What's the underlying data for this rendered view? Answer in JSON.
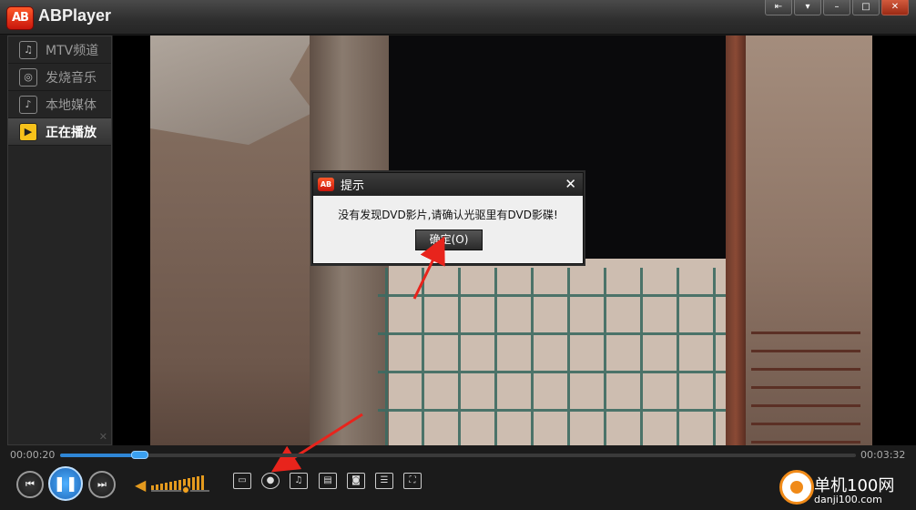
{
  "app": {
    "logo_text": "AB",
    "title": "ABPlayer"
  },
  "window_controls": [
    "restore-mini-icon",
    "dropdown-icon",
    "minimize-icon",
    "maximize-icon",
    "close-icon"
  ],
  "sidebar": {
    "items": [
      {
        "label": "MTV频道",
        "icon": "music-score-icon",
        "active": false
      },
      {
        "label": "发烧音乐",
        "icon": "disc-icon",
        "active": false
      },
      {
        "label": "本地媒体",
        "icon": "music-note-icon",
        "active": false
      },
      {
        "label": "正在播放",
        "icon": "play-icon",
        "active": true
      }
    ]
  },
  "dialog": {
    "logo_text": "AB",
    "title": "提示",
    "message": "没有发现DVD影片,请确认光驱里有DVD影碟!",
    "ok_label": "确定(O)"
  },
  "playback": {
    "current_time": "00:00:20",
    "total_time": "00:03:32",
    "progress": 0.1
  },
  "volume": {
    "level": 0.6
  },
  "toolbar_icons": [
    "folder-icon",
    "dvd-disc-icon",
    "music-library-icon",
    "subtitle-icon",
    "screenshot-icon",
    "playlist-icon",
    "fullscreen-icon"
  ],
  "watermark": {
    "site": "单机100网",
    "domain": "danji100.com"
  },
  "colors": {
    "accent_blue": "#2f86d6",
    "volume_orange": "#e49a1e",
    "logo_red": "#e0301a"
  }
}
